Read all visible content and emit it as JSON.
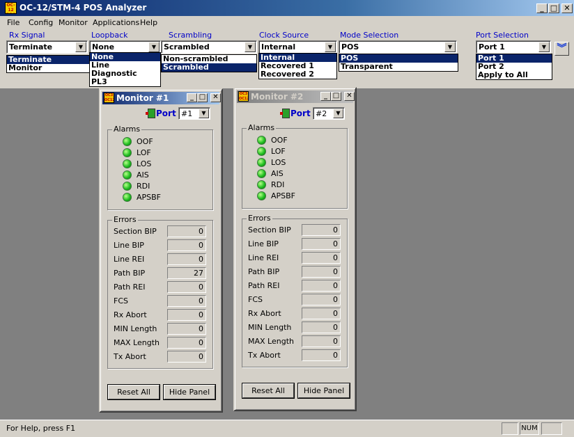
{
  "window": {
    "title": "OC-12/STM-4 POS Analyzer",
    "icon_text": "OC-12 POS",
    "min_glyph": "_",
    "max_glyph": "□",
    "close_glyph": "✕"
  },
  "menu": [
    "File",
    "Config",
    "Monitor",
    "Applications",
    "Help"
  ],
  "controls": {
    "rx_signal": {
      "label": "Rx Signal",
      "value": "Terminate",
      "options": [
        "Terminate",
        "Monitor"
      ],
      "selected": 0
    },
    "loopback": {
      "label": "Loopback",
      "value": "None",
      "options": [
        "None",
        "Line",
        "Diagnostic",
        "PL3"
      ],
      "selected": 0
    },
    "scrambling": {
      "label": "Scrambling",
      "value": "Scrambled",
      "options": [
        "Non-scrambled",
        "Scrambled"
      ],
      "selected": 1
    },
    "clock_source": {
      "label": "Clock Source",
      "value": "Internal",
      "options": [
        "Internal",
        "Recovered 1",
        "Recovered 2"
      ],
      "selected": 0
    },
    "mode_selection": {
      "label": "Mode Selection",
      "value": "POS",
      "options": [
        "POS",
        "Transparent"
      ],
      "selected": 0
    },
    "port_selection": {
      "label": "Port Selection",
      "value": "Port 1",
      "options": [
        "Port 1",
        "Port 2",
        "Apply to All"
      ],
      "selected": 0
    }
  },
  "arrow_glyph": "▼",
  "chevron_glyph": "︾",
  "monitors": [
    {
      "title": "Monitor #1",
      "port_label": "Port",
      "port_value": "#1",
      "alarms_label": "Alarms",
      "alarms": [
        "OOF",
        "LOF",
        "LOS",
        "AIS",
        "RDI",
        "APSBF"
      ],
      "errors_label": "Errors",
      "errors": [
        {
          "label": "Section BIP",
          "value": "0"
        },
        {
          "label": "Line BIP",
          "value": "0"
        },
        {
          "label": "Line REI",
          "value": "0"
        },
        {
          "label": "Path BIP",
          "value": "27"
        },
        {
          "label": "Path REI",
          "value": "0"
        },
        {
          "label": "FCS",
          "value": "0"
        },
        {
          "label": "Rx Abort",
          "value": "0"
        },
        {
          "label": "MIN Length",
          "value": "0"
        },
        {
          "label": "MAX Length",
          "value": "0"
        },
        {
          "label": "Tx Abort",
          "value": "0"
        }
      ],
      "reset_label": "Reset All",
      "hide_label": "Hide Panel"
    },
    {
      "title": "Monitor #2",
      "port_label": "Port",
      "port_value": "#2",
      "alarms_label": "Alarms",
      "alarms": [
        "OOF",
        "LOF",
        "LOS",
        "AIS",
        "RDI",
        "APSBF"
      ],
      "errors_label": "Errors",
      "errors": [
        {
          "label": "Section BIP",
          "value": "0"
        },
        {
          "label": "Line BIP",
          "value": "0"
        },
        {
          "label": "Line REI",
          "value": "0"
        },
        {
          "label": "Path BIP",
          "value": "0"
        },
        {
          "label": "Path REI",
          "value": "0"
        },
        {
          "label": "FCS",
          "value": "0"
        },
        {
          "label": "Rx Abort",
          "value": "0"
        },
        {
          "label": "MIN Length",
          "value": "0"
        },
        {
          "label": "MAX Length",
          "value": "0"
        },
        {
          "label": "Tx Abort",
          "value": "0"
        }
      ],
      "reset_label": "Reset All",
      "hide_label": "Hide Panel"
    }
  ],
  "status": {
    "help_text": "For Help, press F1",
    "num_indicator": "NUM"
  },
  "colors": {
    "title_active": "#0a246a",
    "face": "#d4d0c8",
    "desktop": "#808080",
    "label_blue": "#0000c8",
    "led_green": "#22c022"
  }
}
